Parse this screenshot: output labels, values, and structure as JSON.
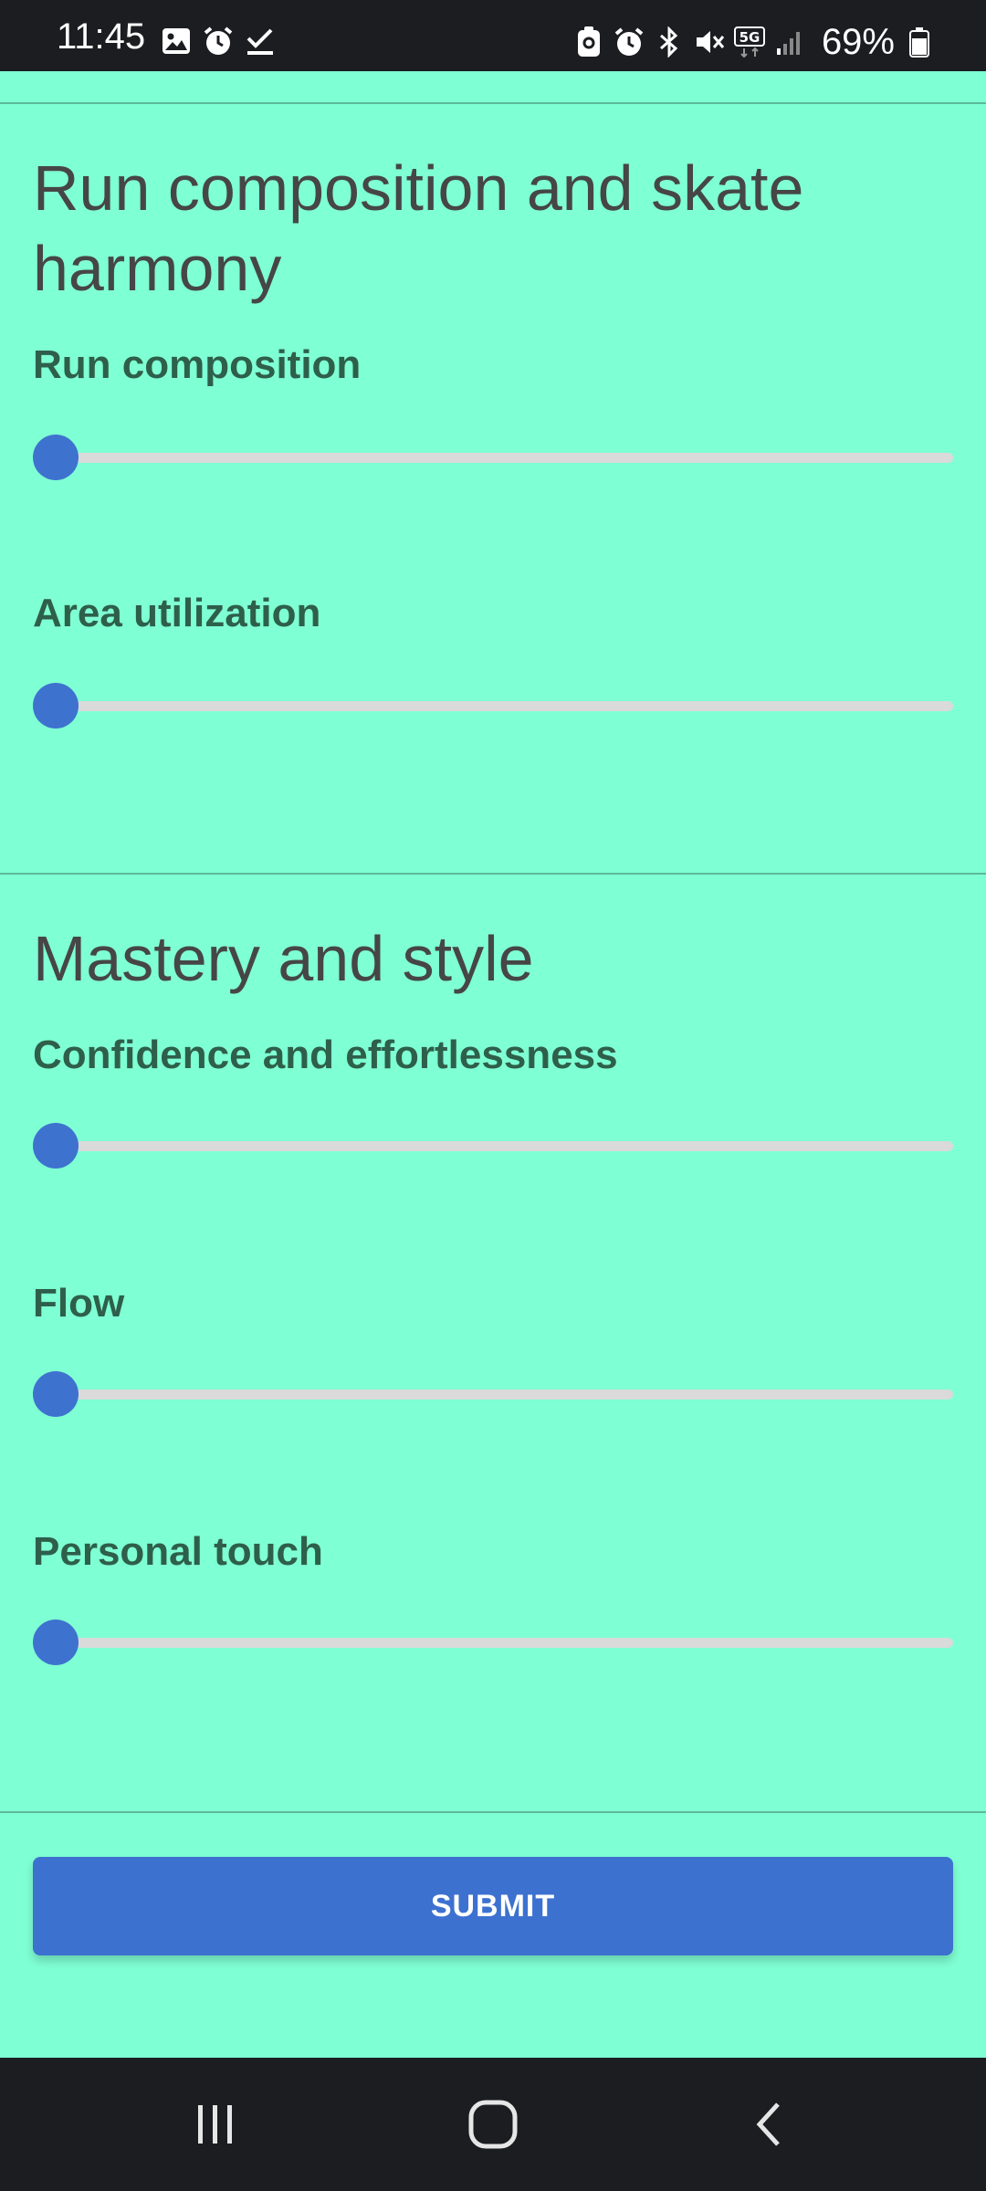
{
  "status_bar": {
    "time": "11:45",
    "battery_percent": "69%",
    "icons_left": [
      "gallery-icon",
      "alarm-icon",
      "check-icon"
    ],
    "icons_right": [
      "lock-screen-icon",
      "alarm-icon",
      "bluetooth-icon",
      "mute-icon",
      "5g-icon",
      "signal-icon",
      "battery-icon"
    ]
  },
  "sections": [
    {
      "title": "Run composition and skate harmony",
      "questions": [
        {
          "label": "Run composition",
          "value": 0
        },
        {
          "label": "Area utilization",
          "value": 0
        }
      ]
    },
    {
      "title": "Mastery and style",
      "questions": [
        {
          "label": "Confidence and effortlessness",
          "value": 0
        },
        {
          "label": "Flow",
          "value": 0
        },
        {
          "label": "Personal touch",
          "value": 0
        }
      ]
    }
  ],
  "submit_label": "SUBMIT",
  "colors": {
    "background": "#7fffd4",
    "accent": "#3d71d0",
    "track": "#dadada",
    "label": "#2e5f4a",
    "title": "#464646"
  },
  "nav_bar": {
    "buttons": [
      "recent-apps-icon",
      "home-icon",
      "back-icon"
    ]
  }
}
